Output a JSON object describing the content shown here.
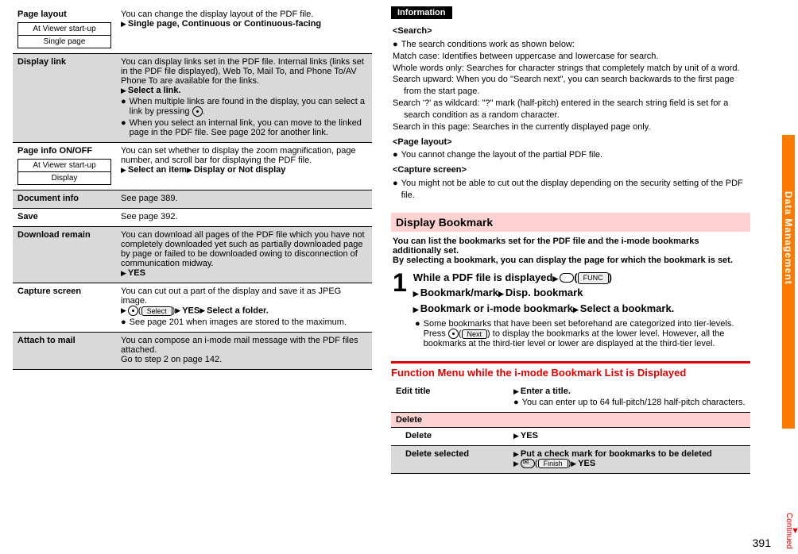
{
  "left_table": {
    "page_layout": {
      "label": "Page layout",
      "box_top": "At Viewer start-up",
      "box_bottom": "Single page",
      "line1": "You can change the display layout of the PDF file.",
      "line2": "Single page, Continuous or Continuous-facing"
    },
    "display_link": {
      "label": "Display link",
      "line1": "You can display links set in the PDF file. Internal links (links set in the PDF file displayed), Web To, Mail To, and Phone To/AV Phone To are available for the links.",
      "line2": "Select a link.",
      "b1": "When multiple links are found in the display, you can select a link by pressing ",
      "b1_end": ".",
      "b2": "When you select an internal link, you can move to the linked page in the PDF file. See page 202 for another link."
    },
    "page_info": {
      "label": "Page info ON/OFF",
      "box_top": "At Viewer start-up",
      "box_bottom": "Display",
      "line1": "You can set whether to display the zoom magnification, page number, and scroll bar for displaying the PDF file.",
      "line2a": "Select an item",
      "line2b": "Display or Not display"
    },
    "document_info": {
      "label": "Document info",
      "text": "See page 389."
    },
    "save": {
      "label": "Save",
      "text": "See page 392."
    },
    "download_remain": {
      "label": "Download remain",
      "line1": "You can download all pages of the PDF file which you have not completely downloaded yet such as partially downloaded page by page or failed to be downloaded owing to disconnection of communication midway.",
      "line2": "YES"
    },
    "capture_screen": {
      "label": "Capture screen",
      "line1": "You can cut out a part of the display and save it as JPEG image.",
      "btn": "Select",
      "line2a": "YES",
      "line2b": "Select a folder.",
      "b1": "See page 201 when images are stored to the maximum."
    },
    "attach_mail": {
      "label": "Attach to mail",
      "line1": "You can compose an i-mode mail message with the PDF files attached.",
      "line2": "Go to step 2 on page 142."
    }
  },
  "info": {
    "tag": "Information",
    "search_hdr": "<Search>",
    "search_main": "The search conditions work as shown below:",
    "s1": "Match case: Identifies between uppercase and lowercase for search.",
    "s2": "Whole words only: Searches for character strings that completely match by unit of a word.",
    "s3": "Search upward: When you do \"Search next\", you can search backwards to the first page from the start page.",
    "s4": "Search '?' as wildcard: \"?\" mark (half-pitch) entered in the search string field is set for a search condition as a random character.",
    "s5": "Search in this page: Searches in the currently displayed page only.",
    "pl_hdr": "<Page layout>",
    "pl1": "You cannot change the layout of the partial PDF file.",
    "cs_hdr": "<Capture screen>",
    "cs1": "You might not be able to cut out the display depending on the security setting of the PDF file."
  },
  "display_bookmark": {
    "title": "Display Bookmark",
    "p1": "You can list the bookmarks set for the PDF file and the i-mode bookmarks additionally set.",
    "p2": "By selecting a bookmark, you can display the page for which the bookmark is set.",
    "step_num": "1",
    "step_l1a": "While a PDF file is displayed",
    "func_btn": "FUNC",
    "step_l2a": "Bookmark/mark",
    "step_l2b": "Disp. bookmark",
    "step_l3a": "Bookmark or i-mode bookmark",
    "step_l3b": "Select a bookmark.",
    "note_a": "Some bookmarks that have been set beforehand are categorized into tier-levels. Press ",
    "note_btn": "Next",
    "note_b": " to display the bookmarks at the lower level. However, all the bookmarks at the third-tier level or lower are displayed at the third-tier level."
  },
  "func_menu": {
    "title": "Function Menu while the i-mode Bookmark List is Displayed",
    "edit_title": {
      "label": "Edit title",
      "l1": "Enter a title.",
      "l2": "You can enter up to 64 full-pitch/128 half-pitch characters."
    },
    "delete_hdr": "Delete",
    "delete": {
      "label": "Delete",
      "l1": "YES"
    },
    "delete_selected": {
      "label": "Delete selected",
      "l1": "Put a check mark for bookmarks to be deleted",
      "btn": "Finish",
      "l2": "YES"
    }
  },
  "side_tab": "Data Management",
  "page_number": "391",
  "continued": "Continued"
}
